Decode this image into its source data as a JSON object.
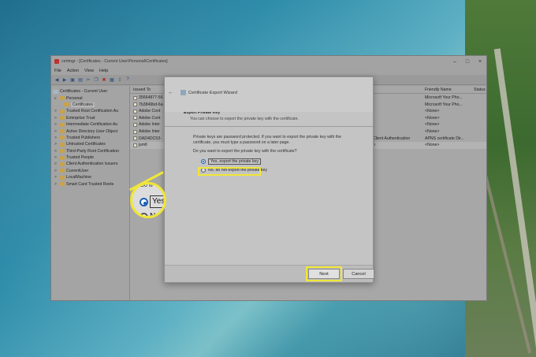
{
  "window": {
    "title": "certmgr - [Certificates - Current User\\Personal\\Certificates]",
    "menu": [
      "File",
      "Action",
      "View",
      "Help"
    ]
  },
  "tree": [
    {
      "label": "Certificates - Current User",
      "chev": ""
    },
    {
      "label": "Personal",
      "chev": "v"
    },
    {
      "label": "Certificates",
      "chev": ""
    },
    {
      "label": "Trusted Root Certification Au",
      "chev": ">"
    },
    {
      "label": "Enterprise Trust",
      "chev": ">"
    },
    {
      "label": "Intermediate Certification Au",
      "chev": ">"
    },
    {
      "label": "Active Directory User Object",
      "chev": ">"
    },
    {
      "label": "Trusted Publishers",
      "chev": ">"
    },
    {
      "label": "Untrusted Certificates",
      "chev": ">"
    },
    {
      "label": "Third-Party Root Certification",
      "chev": ">"
    },
    {
      "label": "Trusted People",
      "chev": ">"
    },
    {
      "label": "Client Authentication Issuers",
      "chev": ">"
    },
    {
      "label": "CurrentUser",
      "chev": ">"
    },
    {
      "label": "LocalMachine",
      "chev": ">"
    },
    {
      "label": "Smart Card Trusted Roots",
      "chev": ">"
    }
  ],
  "list": {
    "headers": {
      "issued_to": "Issued To",
      "friendly": "Friendly Name",
      "status": "Status"
    },
    "rows": [
      {
        "issued": "35664877-56",
        "purpose": "",
        "friendly": "Microsoft Your Pho..."
      },
      {
        "issued": "7b3849bd-6a",
        "purpose": "",
        "friendly": "Microsoft Your Pho..."
      },
      {
        "issued": "Adobe Cont",
        "purpose": "",
        "friendly": "<None>"
      },
      {
        "issued": "Adobe Cont",
        "purpose": "",
        "friendly": "<None>"
      },
      {
        "issued": "Adobe Inter",
        "purpose": "",
        "friendly": "<None>"
      },
      {
        "issued": "Adobe Inter",
        "purpose": "",
        "friendly": "<None>"
      },
      {
        "issued": "DAD4DC53-",
        "purpose": "Client Authentication",
        "friendly": "APNS certificate Dir..."
      },
      {
        "issued": "jsmfi",
        "purpose": "n",
        "friendly": "<None>"
      }
    ]
  },
  "dialog": {
    "title": "Certificate Export Wizard",
    "section_title": "Export Private Key",
    "section_sub": "You can choose to export the private key with the certificate.",
    "para1": "Private keys are password protected. If you want to export the private key with the certificate, you must type a password on a later page.",
    "question": "Do you want to export the private key with the certificate?",
    "option_yes": "Yes, export the private key",
    "option_no": "No, do not export the private key",
    "next": "Next",
    "cancel": "Cancel"
  },
  "zoom": {
    "top": "Do w",
    "yes": "Yes,",
    "no": "No"
  },
  "colors": {
    "highlight": "#f0e637",
    "radio_selected": "#1a5fb4"
  }
}
